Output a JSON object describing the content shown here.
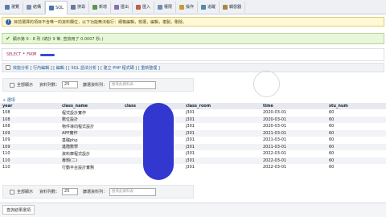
{
  "tabs": [
    {
      "label": "瀏覽",
      "icon": "browse-icon",
      "color": "#5a7bb5",
      "active": false
    },
    {
      "label": "結構",
      "icon": "structure-icon",
      "color": "#7a8cab",
      "active": false
    },
    {
      "label": "SQL",
      "icon": "sql-icon",
      "color": "#4c6fb0",
      "active": true
    },
    {
      "label": "搜尋",
      "icon": "search-icon",
      "color": "#6a7a9a",
      "active": false
    },
    {
      "label": "新增",
      "icon": "insert-icon",
      "color": "#5d9450",
      "active": false
    },
    {
      "label": "匯出",
      "icon": "export-icon",
      "color": "#8a6fb0",
      "active": false
    },
    {
      "label": "匯入",
      "icon": "import-icon",
      "color": "#c05e4a",
      "active": false
    },
    {
      "label": "權限",
      "icon": "privileges-icon",
      "color": "#6b8db8",
      "active": false
    },
    {
      "label": "操作",
      "icon": "operations-icon",
      "color": "#c89a38",
      "active": false
    },
    {
      "label": "追蹤",
      "icon": "tracking-icon",
      "color": "#4f8aa6",
      "active": false
    },
    {
      "label": "觸發器",
      "icon": "triggers-icon",
      "color": "#a8883a",
      "active": false
    }
  ],
  "warning": {
    "icon": "info-icon",
    "text": "目前選擇的項目不含唯一的資料欄位，以下功能無法執行：網格編輯，核選，編輯，複製，刪除。"
  },
  "success": {
    "icon": "checkmark-icon",
    "text": "顯示第 0 - 8 列 (總計 9 筆, 查詢用了 0.0007 秒。)"
  },
  "query": {
    "select": "SELECT",
    "star": "*",
    "from": "FROM"
  },
  "links": "效能分析 [ 行內編輯 ] [ 編輯 ] [ SQL 語法分析 ] [ 建立 PHP 程式碼 ] [ 重新整理 ]",
  "controls": {
    "show_all": "全部顯示",
    "row_count_label": "資料列數：",
    "row_count": "25",
    "filter_label": "篩選資料列：",
    "filter_placeholder": "搜尋此資料表"
  },
  "options_label": "+ 選項",
  "table": {
    "columns": [
      "year",
      "class_name",
      "class",
      "class_room",
      "time",
      "stu_num"
    ],
    "rows": [
      [
        "108",
        "程式設計實作",
        "",
        "j301",
        "2020-03-01",
        "60"
      ],
      [
        "108",
        "數位設計",
        "",
        "j301",
        "2020-03-01",
        "60"
      ],
      [
        "108",
        "物件導向程式設計",
        "",
        "j301",
        "2020-03-01",
        "60"
      ],
      [
        "109",
        "APP實作",
        "",
        "j301",
        "2021-03-01",
        "60"
      ],
      [
        "109",
        "基礎php",
        "",
        "j301",
        "2021-03-01",
        "60"
      ],
      [
        "109",
        "進階數學",
        "",
        "j301",
        "2021-03-01",
        "60"
      ],
      [
        "110",
        "資料庫程式設計",
        "",
        "j301",
        "2022-03-01",
        "60"
      ],
      [
        "110",
        "專題(二)",
        "",
        "j301",
        "2022-03-01",
        "60"
      ],
      [
        "110",
        "行動平台設計實務",
        "",
        "j301",
        "2022-03-01",
        "60"
      ]
    ]
  },
  "footer": {
    "query_results": "查詢結果選項"
  }
}
